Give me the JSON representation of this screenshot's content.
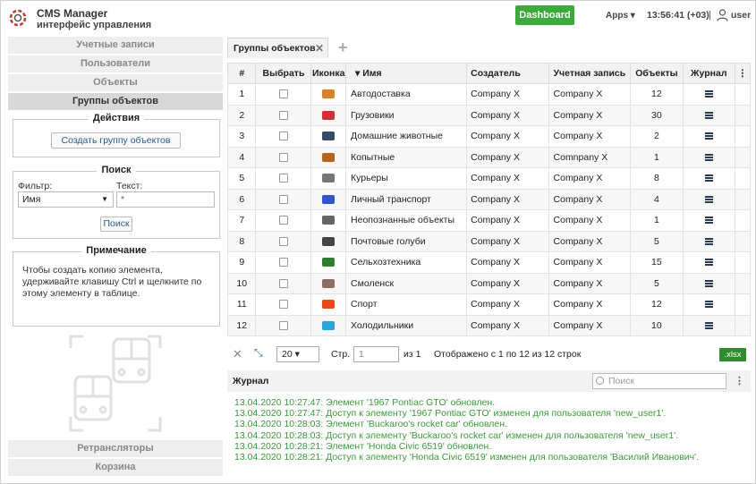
{
  "header": {
    "title": "CMS Manager",
    "subtitle": "интерфейс управления",
    "dashboard_label": "Dashboard",
    "apps_label": "Apps ▾",
    "time": "13:56:41 (+03)",
    "separator": "|",
    "user": "user"
  },
  "sidebar": {
    "top_items": [
      {
        "label": "Учетные записи"
      },
      {
        "label": "Пользователи"
      },
      {
        "label": "Объекты"
      },
      {
        "label": "Группы объектов"
      }
    ],
    "actions": {
      "legend": "Действия",
      "create_label": "Создать группу объектов"
    },
    "search": {
      "legend": "Поиск",
      "filter_label": "Фильтр:",
      "filter_value": "Имя",
      "text_label": "Текст:",
      "text_value": "*",
      "button_label": "Поиск"
    },
    "note": {
      "legend": "Примечание",
      "text": "Чтобы создать копию элемента, удерживайте клавишу Ctrl и щелкните по этому элементу в таблице."
    },
    "bottom_items": [
      {
        "label": "Ретрансляторы"
      },
      {
        "label": "Корзина"
      }
    ]
  },
  "tabs": [
    {
      "label": "Группы объектов",
      "close": "✕"
    }
  ],
  "add_tab": "+",
  "table": {
    "headers": [
      "#",
      "Выбрать",
      "Иконка",
      "▾ Имя",
      "Создатель",
      "Учетная запись",
      "Объекты",
      "Журнал",
      "⋮"
    ],
    "rows": [
      {
        "num": "1",
        "name": "Автодоставка",
        "creator": "Company X",
        "account": "Company X",
        "objects": "12",
        "icon_color": "#d9822b"
      },
      {
        "num": "2",
        "name": "Грузовики",
        "creator": "Company X",
        "account": "Company X",
        "objects": "30",
        "icon_color": "#cc3333"
      },
      {
        "num": "3",
        "name": "Домашние животные",
        "creator": "Company X",
        "account": "Company X",
        "objects": "2",
        "icon_color": "#3a4a6a"
      },
      {
        "num": "4",
        "name": "Копытные",
        "creator": "Company X",
        "account": "Comnpany X",
        "objects": "1",
        "icon_color": "#b5651d"
      },
      {
        "num": "5",
        "name": "Курьеры",
        "creator": "Company X",
        "account": "Company X",
        "objects": "8",
        "icon_color": "#777777"
      },
      {
        "num": "6",
        "name": "Личный транспорт",
        "creator": "Company X",
        "account": "Company X",
        "objects": "4",
        "icon_color": "#3355cc"
      },
      {
        "num": "7",
        "name": "Неопознанные объекты",
        "creator": "Company X",
        "account": "Company X",
        "objects": "1",
        "icon_color": "#666666"
      },
      {
        "num": "8",
        "name": "Почтовые голуби",
        "creator": "Company X",
        "account": "Company X",
        "objects": "5",
        "icon_color": "#444444"
      },
      {
        "num": "9",
        "name": "Сельхозтехника",
        "creator": "Company X",
        "account": "Company X",
        "objects": "15",
        "icon_color": "#2e7d32"
      },
      {
        "num": "10",
        "name": "Смоленск",
        "creator": "Company X",
        "account": "Company X",
        "objects": "5",
        "icon_color": "#8d6e63"
      },
      {
        "num": "11",
        "name": "Спорт",
        "creator": "Company X",
        "account": "Company X",
        "objects": "12",
        "icon_color": "#e64a19"
      },
      {
        "num": "12",
        "name": "Холодильники",
        "creator": "Company X",
        "account": "Company X",
        "objects": "10",
        "icon_color": "#29a3d8"
      }
    ]
  },
  "pager": {
    "close": "✕",
    "fit": "⤡",
    "page_size": "20 ▾",
    "page_label": "Стр.",
    "page_value": "1",
    "of": "из 1",
    "shown": "Отображено с 1 по 12 из 12 строк",
    "export": ".xlsx"
  },
  "journal": {
    "title": "Журнал",
    "search_placeholder": "Поиск",
    "more": "⋮",
    "lines": [
      "13.04.2020 10:27:47: Элемент '1967 Pontiac GTO' обновлен.",
      "13.04.2020 10:27:47: Доступ к элементу '1967 Pontiac GTO' изменен для пользователя 'new_user1'.",
      "13.04.2020 10:28:03: Элемент 'Buckaroo's rocket car' обновлен.",
      "13.04.2020 10:28:03: Доступ к элементу 'Buckaroo's rocket car' изменен для пользователя 'new_user1'.",
      "13.04.2020 10:28:21: Элемент 'Honda Civic 6519' обновлен.",
      "13.04.2020 10:28:21: Доступ к элементу 'Honda Civic 6519' изменен для пользователя 'Василий Иванович'."
    ]
  }
}
